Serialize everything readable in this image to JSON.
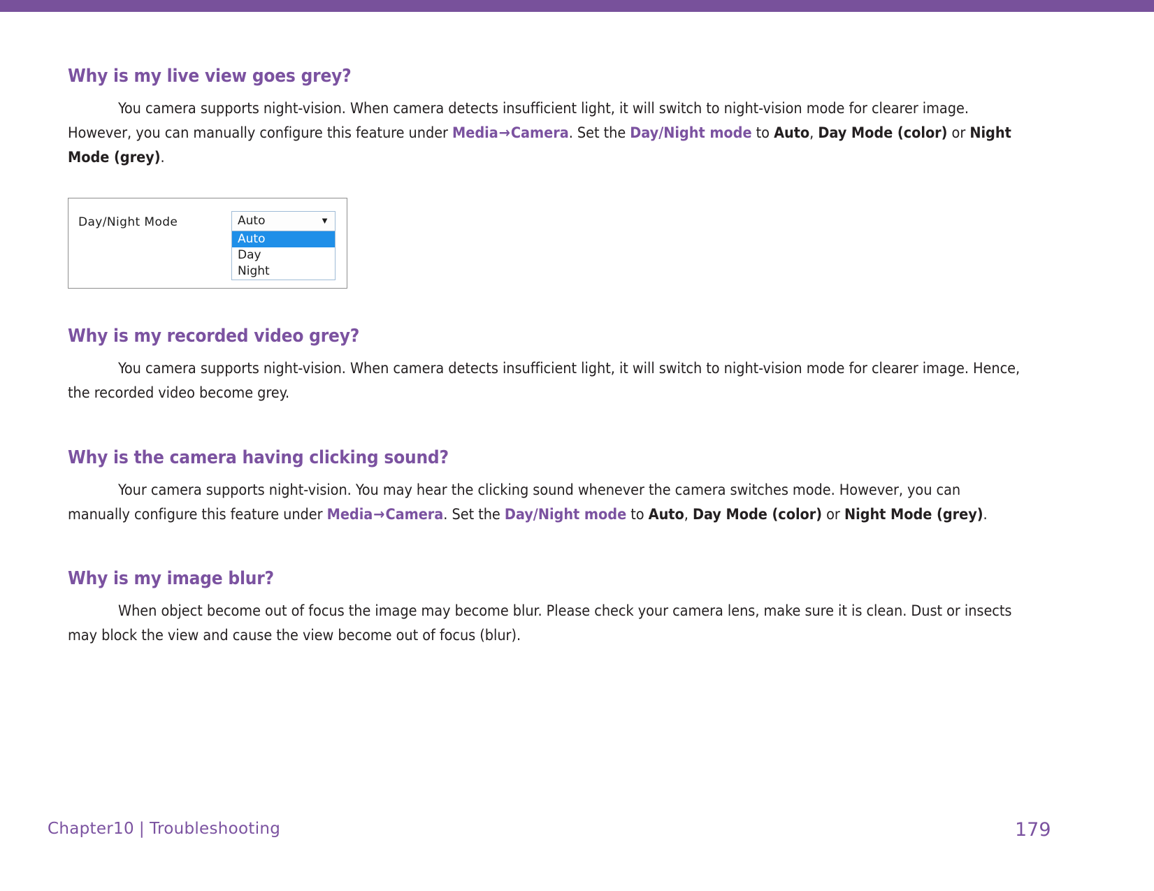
{
  "theme": {
    "accent": "#7b52a0",
    "top_band": "#78519b",
    "body_text": "#231f20",
    "highlight_blue": "#1f8fe8"
  },
  "sections": [
    {
      "heading": "Why is my live view goes grey?",
      "body_runs": [
        {
          "text": "You camera supports night-vision. When camera detects insufficient light, it will switch to night-vision mode for clearer image. However, you can manually configure this feature under ",
          "style": "normal"
        },
        {
          "text": "Media",
          "style": "purple"
        },
        {
          "text": "→",
          "style": "arrow"
        },
        {
          "text": "Camera",
          "style": "purple"
        },
        {
          "text": ". Set the ",
          "style": "normal"
        },
        {
          "text": "Day/Night mode",
          "style": "purple"
        },
        {
          "text": " to ",
          "style": "normal"
        },
        {
          "text": "Auto",
          "style": "bold"
        },
        {
          "text": ", ",
          "style": "normal"
        },
        {
          "text": "Day Mode (color)",
          "style": "bold"
        },
        {
          "text": " or ",
          "style": "normal"
        },
        {
          "text": "Night Mode (grey)",
          "style": "bold"
        },
        {
          "text": ".",
          "style": "normal"
        }
      ]
    },
    {
      "heading": "Why is my recorded video grey?",
      "body_runs": [
        {
          "text": "You camera supports night-vision. When camera detects insufficient light, it will switch to night-vision mode for clearer image. Hence, the recorded video become grey.",
          "style": "normal"
        }
      ]
    },
    {
      "heading": "Why is the camera having clicking sound?",
      "body_runs": [
        {
          "text": "Your camera supports night-vision. You may hear the clicking sound whenever the camera switches mode. However, you can manually configure this feature under ",
          "style": "normal"
        },
        {
          "text": "Media",
          "style": "purple"
        },
        {
          "text": "→",
          "style": "arrow"
        },
        {
          "text": "Camera",
          "style": "purple"
        },
        {
          "text": ". Set the ",
          "style": "normal"
        },
        {
          "text": "Day/Night mode",
          "style": "purple"
        },
        {
          "text": " to ",
          "style": "normal"
        },
        {
          "text": "Auto",
          "style": "bold"
        },
        {
          "text": ", ",
          "style": "normal"
        },
        {
          "text": "Day Mode (color)",
          "style": "bold"
        },
        {
          "text": " or ",
          "style": "normal"
        },
        {
          "text": "Night Mode (grey)",
          "style": "bold"
        },
        {
          "text": ".",
          "style": "normal"
        }
      ]
    },
    {
      "heading": "Why is my image blur?",
      "body_runs": [
        {
          "text": "When object become out of focus the image may become blur. Please check your camera lens, make sure it is clean. Dust or insects may block the view and cause the view become out of focus (blur).",
          "style": "normal"
        }
      ]
    }
  ],
  "figure": {
    "field_label": "Day/Night Mode",
    "selected_value": "Auto",
    "caret_icon": "▼",
    "options": [
      "Auto",
      "Day",
      "Night"
    ],
    "selected_index": 0
  },
  "footer": {
    "chapter": "Chapter10",
    "separator": "|",
    "section": "Troubleshooting",
    "page_number": "179"
  }
}
